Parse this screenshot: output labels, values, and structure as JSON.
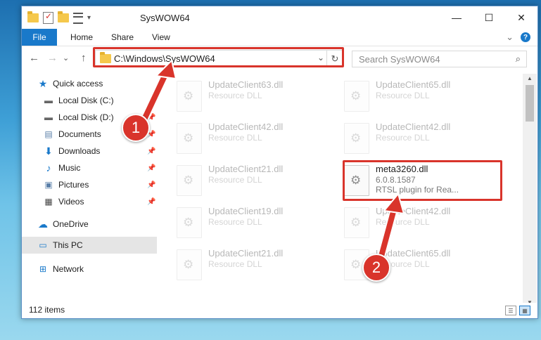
{
  "window": {
    "title": "SysWOW64",
    "minimize": "—",
    "maximize": "☐",
    "close": "✕"
  },
  "ribbon": {
    "file_tab": "File",
    "tabs": [
      "Home",
      "Share",
      "View"
    ],
    "expand": "⌄",
    "help": "?"
  },
  "navigation": {
    "back": "←",
    "forward": "→",
    "recent": "⌄",
    "up": "↑",
    "address": "C:\\Windows\\SysWOW64",
    "address_dropdown": "⌄",
    "refresh": "↻",
    "search_placeholder": "Search SysWOW64",
    "search_icon": "⌕"
  },
  "sidebar": {
    "items": [
      {
        "label": "Quick access",
        "icon": "star-icon"
      },
      {
        "label": "Local Disk (C:)",
        "icon": "drive-icon"
      },
      {
        "label": "Local Disk (D:)",
        "icon": "drive-icon"
      },
      {
        "label": "Documents",
        "icon": "documents-icon"
      },
      {
        "label": "Downloads",
        "icon": "download-icon"
      },
      {
        "label": "Music",
        "icon": "music-icon"
      },
      {
        "label": "Pictures",
        "icon": "pictures-icon"
      },
      {
        "label": "Videos",
        "icon": "videos-icon"
      },
      {
        "label": "OneDrive",
        "icon": "cloud-icon"
      },
      {
        "label": "This PC",
        "icon": "computer-icon"
      },
      {
        "label": "Network",
        "icon": "network-icon"
      }
    ],
    "pin_icon": "pin-icon"
  },
  "files": [
    {
      "name": "UpdateClient63.dll",
      "desc": "Resource DLL"
    },
    {
      "name": "UpdateClient65.dll",
      "desc": "Resource DLL"
    },
    {
      "name": "UpdateClient42.dll",
      "desc": "Resource DLL"
    },
    {
      "name": "UpdateClient42.dll",
      "desc": "Resource DLL"
    },
    {
      "name": "UpdateClient21.dll",
      "desc": "Resource DLL"
    },
    {
      "name": "meta3260.dll",
      "desc": "6.0.8.1587",
      "desc2": "RTSL plugin for Rea..."
    },
    {
      "name": "UpdateClient19.dll",
      "desc": "Resource DLL"
    },
    {
      "name": "UpdateClient42.dll",
      "desc": "Resource DLL"
    },
    {
      "name": "UpdateClient21.dll",
      "desc": "Resource DLL"
    },
    {
      "name": "UpdateClient65.dll",
      "desc": "Resource DLL"
    }
  ],
  "status": {
    "items_count": "112 items"
  },
  "annotations": {
    "step1": "1",
    "step2": "2",
    "color": "#d9342b"
  },
  "colors": {
    "accent": "#1979ca",
    "highlight": "#d9342b"
  }
}
